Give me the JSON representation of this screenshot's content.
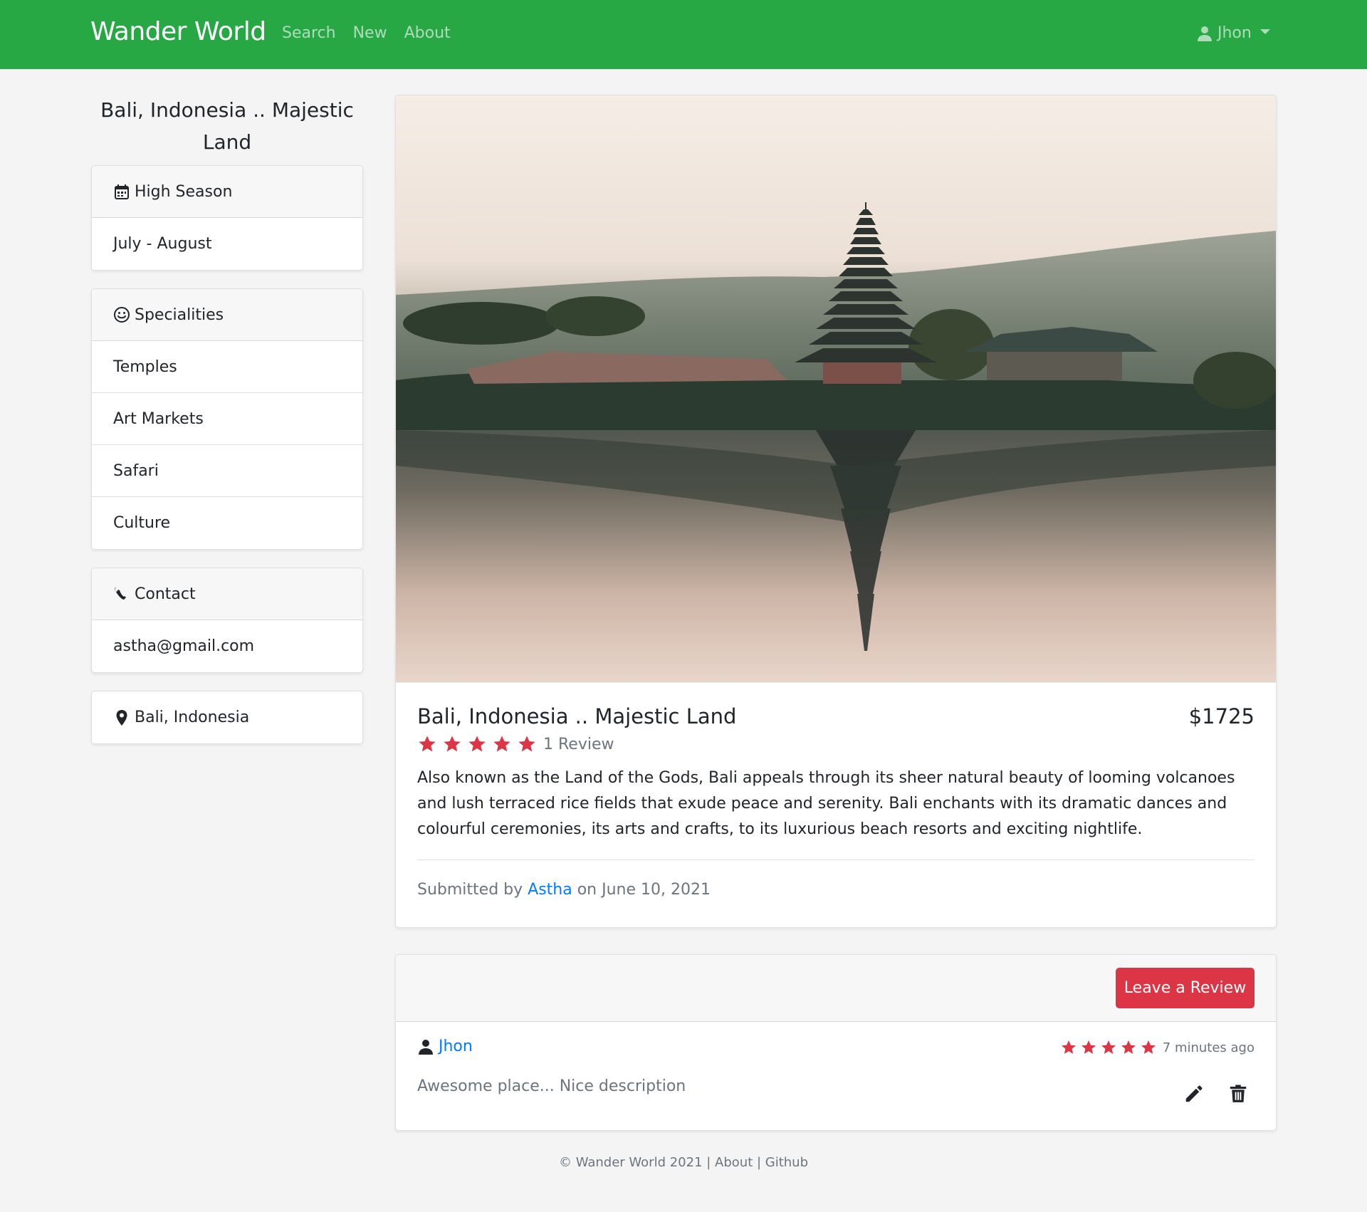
{
  "navbar": {
    "brand": "Wander World",
    "links": [
      "Search",
      "New",
      "About"
    ],
    "user": "Jhon"
  },
  "sidebar": {
    "title": "Bali, Indonesia .. Majestic Land",
    "season": {
      "label": "High Season",
      "value": "July - August"
    },
    "specialities": {
      "label": "Specialities",
      "items": [
        "Temples",
        "Art Markets",
        "Safari",
        "Culture"
      ]
    },
    "contact": {
      "label": "Contact",
      "value": "astha@gmail.com"
    },
    "location": "Bali, Indonesia"
  },
  "listing": {
    "image_alt": "Bali temple on lake",
    "title": "Bali, Indonesia .. Majestic Land",
    "price": "$1725",
    "rating": 5,
    "review_count": "1 Review",
    "description": "Also known as the Land of the Gods, Bali appeals through its sheer natural beauty of looming volcanoes and lush terraced rice fields that exude peace and serenity. Bali enchants with its dramatic dances and colourful ceremonies, its arts and crafts, to its luxurious beach resorts and exciting nightlife.",
    "submitted_prefix": "Submitted by",
    "author": "Astha",
    "submitted_suffix": "on June 10, 2021"
  },
  "reviews": {
    "leave_button": "Leave a Review",
    "items": [
      {
        "user": "Jhon",
        "rating": 5,
        "time": "7 minutes ago",
        "text": "Awesome place... Nice description"
      }
    ]
  },
  "footer": {
    "text": "© Wander World 2021 | About | Github"
  },
  "colors": {
    "navbar": "#28a745",
    "accent_red": "#dc3545",
    "link_blue": "#007bff"
  }
}
